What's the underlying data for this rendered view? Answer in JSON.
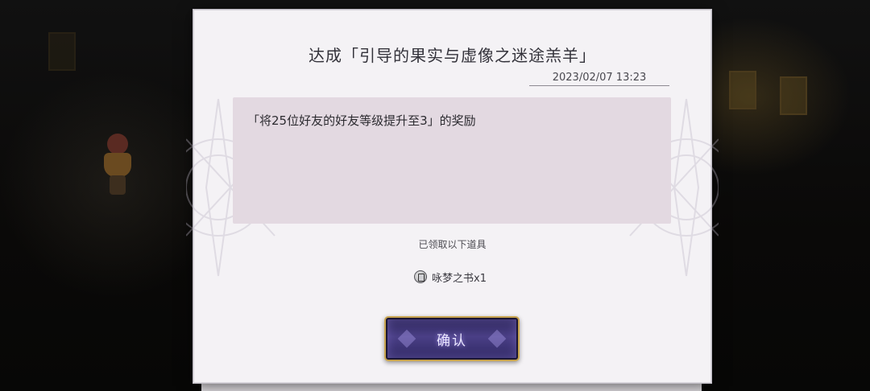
{
  "dialog": {
    "title": "达成「引导的果实与虚像之迷途羔羊」",
    "date": "2023/02/07 13:23",
    "message": "「将25位好友的好友等级提升至3」的奖励",
    "received_label": "已领取以下道具",
    "reward": {
      "icon": "book-item-icon",
      "text": "咏梦之书x1"
    },
    "confirm_label": "确认"
  },
  "colors": {
    "dialog_bg": "#f4f2f5",
    "message_bg": "#e3d9e1",
    "button_gold": "#c8a44e",
    "button_purple": "#4a3f86"
  }
}
